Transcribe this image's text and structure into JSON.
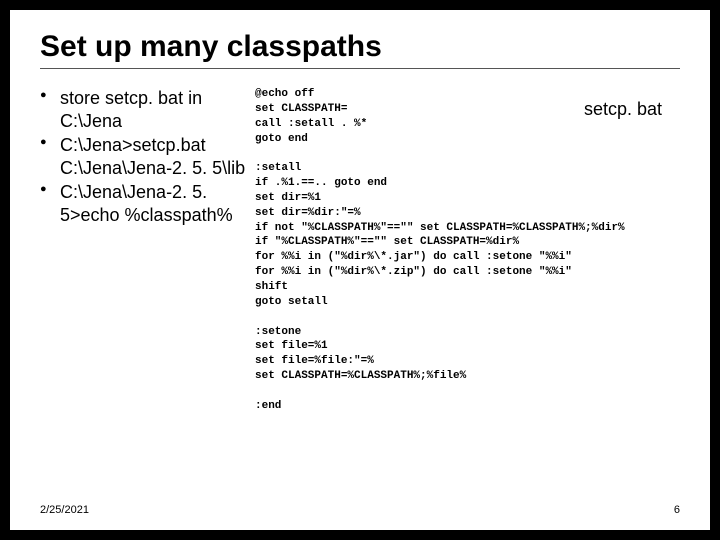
{
  "title": "Set up many classpaths",
  "bullets": [
    "store setcp. bat in C:\\Jena",
    "C:\\Jena>setcp.bat C:\\Jena\\Jena-2. 5. 5\\lib",
    "C:\\Jena\\Jena-2. 5. 5>echo %classpath%"
  ],
  "label": "setcp. bat",
  "code": "@echo off\nset CLASSPATH=\ncall :setall . %*\ngoto end\n\n:setall\nif .%1.==.. goto end\nset dir=%1\nset dir=%dir:\"=%\nif not \"%CLASSPATH%\"==\"\" set CLASSPATH=%CLASSPATH%;%dir%\nif \"%CLASSPATH%\"==\"\" set CLASSPATH=%dir%\nfor %%i in (\"%dir%\\*.jar\") do call :setone \"%%i\"\nfor %%i in (\"%dir%\\*.zip\") do call :setone \"%%i\"\nshift\ngoto setall\n\n:setone\nset file=%1\nset file=%file:\"=%\nset CLASSPATH=%CLASSPATH%;%file%\n\n:end",
  "footer": {
    "date": "2/25/2021",
    "page": "6"
  }
}
